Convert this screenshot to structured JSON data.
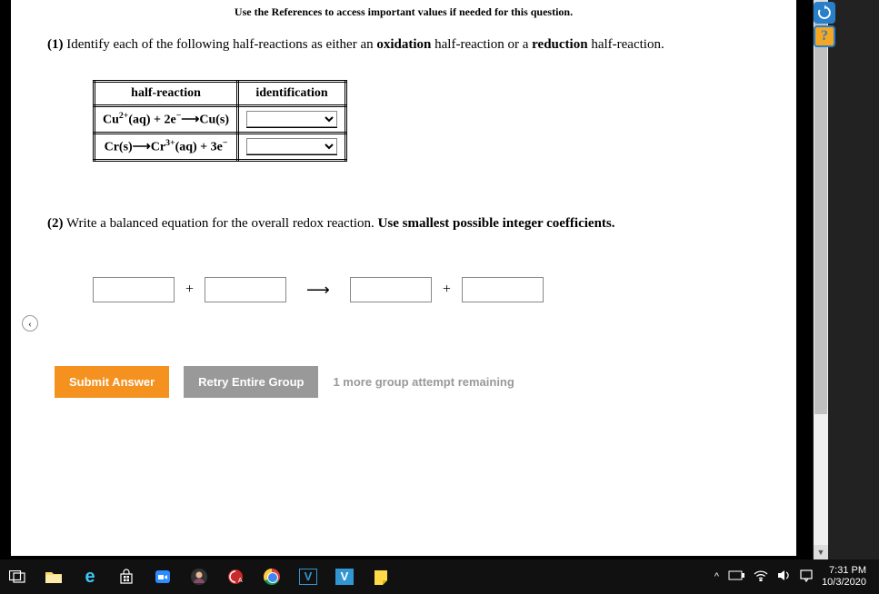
{
  "references_note": "Use the References to access important values if needed for this question.",
  "q1": {
    "number": "(1)",
    "text_before": " Identify each of the following half-reactions as either an ",
    "bold1": "oxidation",
    "text_mid": " half-reaction or a ",
    "bold2": "reduction",
    "text_after": " half-reaction."
  },
  "table": {
    "header1": "half-reaction",
    "header2": "identification",
    "row1_reaction": "Cu²⁺(aq) + 2e⁻ ⟶ Cu(s)",
    "row2_reaction": "Cr(s) ⟶ Cr³⁺(aq) + 3e⁻"
  },
  "q2": {
    "number": "(2)",
    "text": " Write a balanced equation for the overall redox reaction. ",
    "bold": "Use smallest possible integer coefficients."
  },
  "equation": {
    "plus": "+",
    "arrow": "⟶"
  },
  "buttons": {
    "submit": "Submit Answer",
    "retry": "Retry Entire Group",
    "attempts": "1 more group attempt remaining"
  },
  "sys": {
    "time": "7:31 PM",
    "date": "10/3/2020"
  }
}
